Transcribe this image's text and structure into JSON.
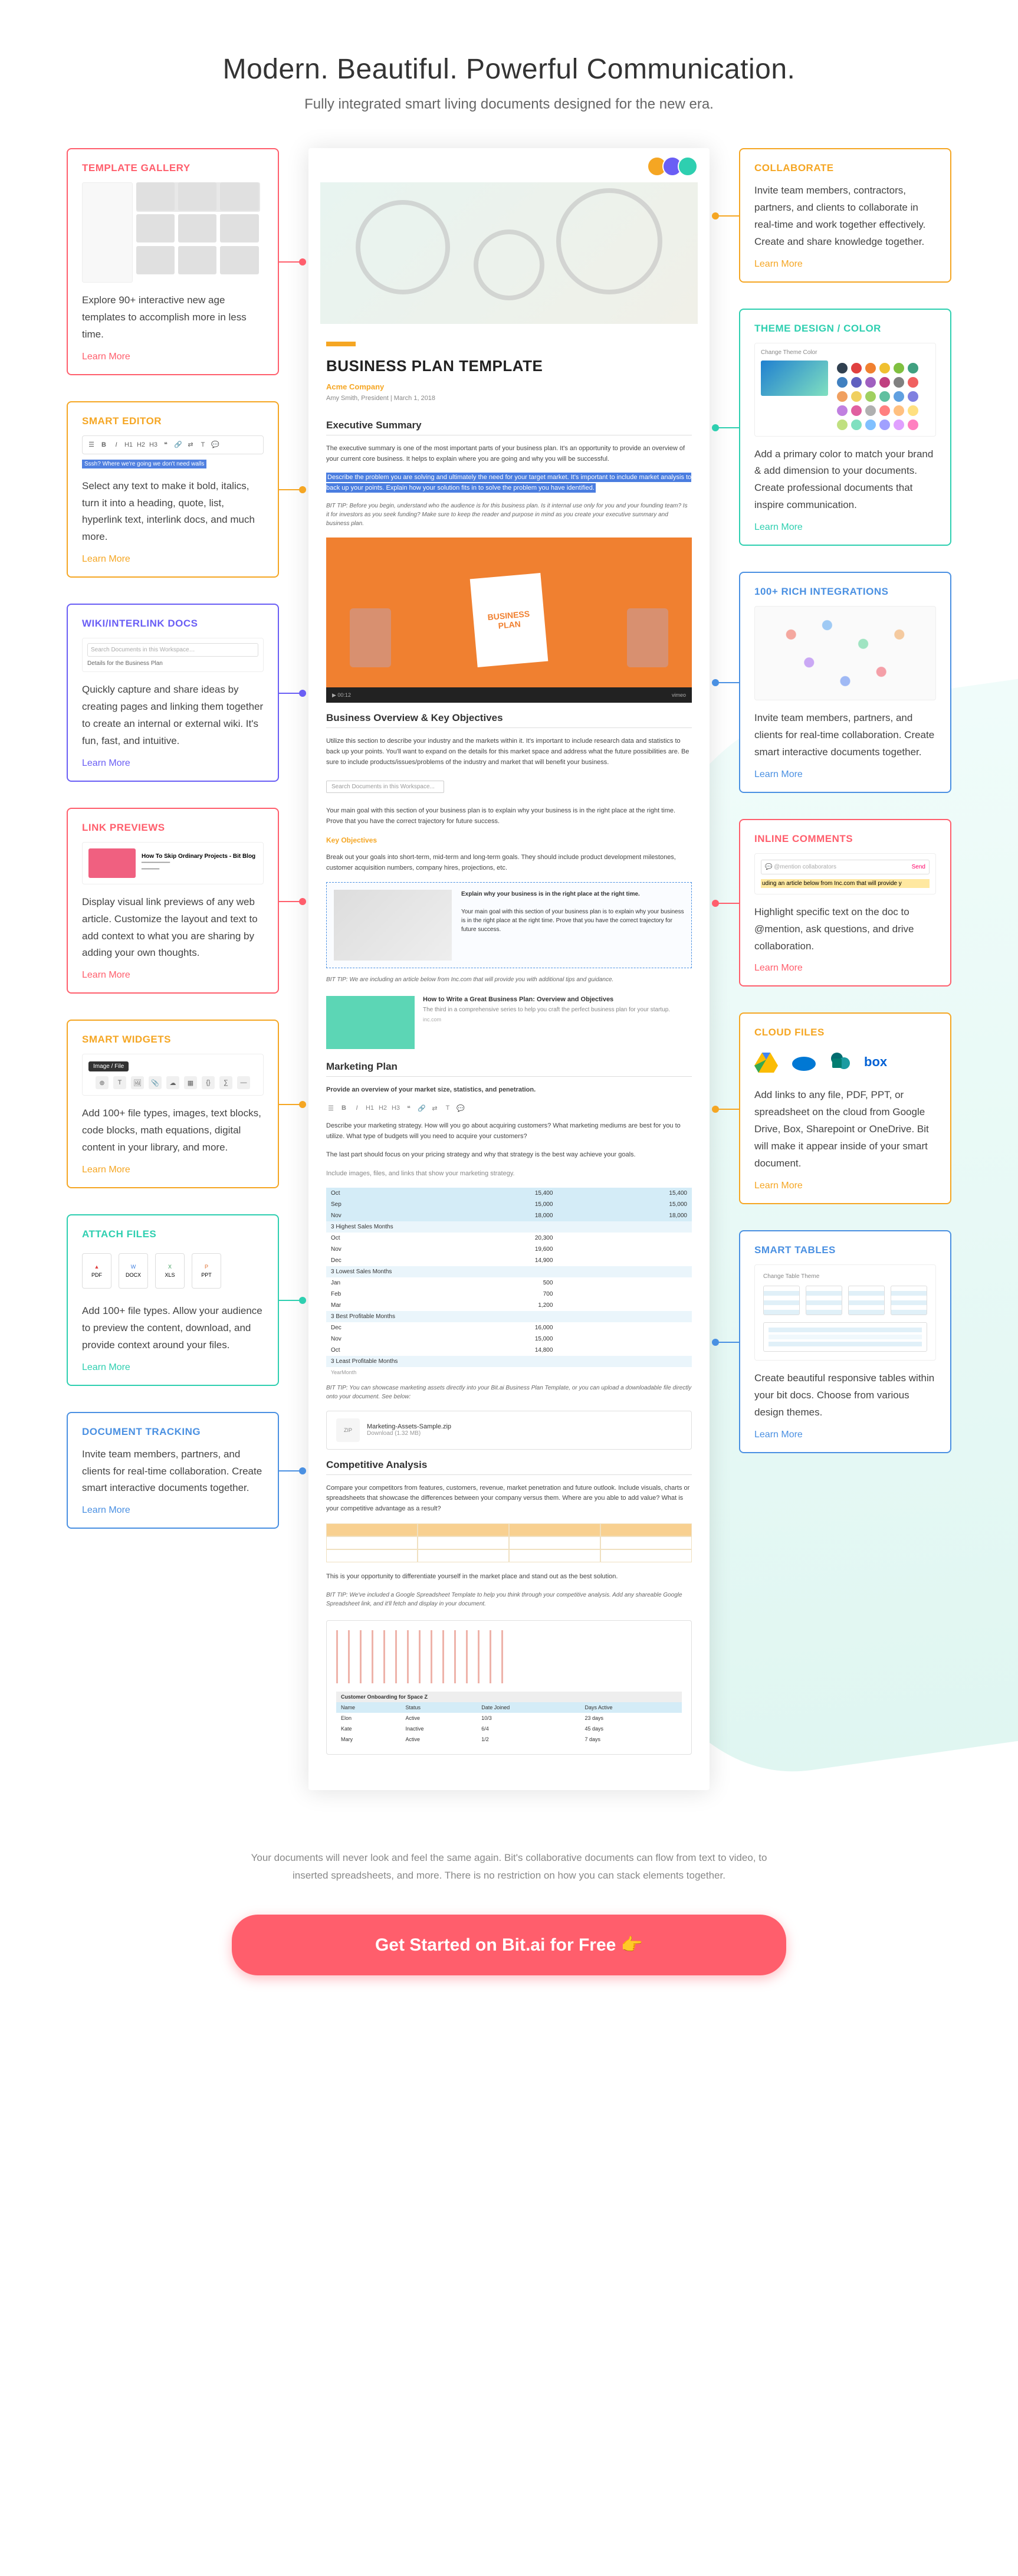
{
  "hero": {
    "title": "Modern. Beautiful. Powerful Communication.",
    "subtitle": "Fully integrated smart living documents designed for the new era."
  },
  "left_cards": [
    {
      "key": "template-gallery",
      "title": "TEMPLATE GALLERY",
      "color": "#ff5e6c",
      "desc": "Explore 90+ interactive new age templates to accomplish more in less time.",
      "learn": "Learn More",
      "thumb": "gallery"
    },
    {
      "key": "smart-editor",
      "title": "SMART EDITOR",
      "color": "#f5a623",
      "desc": "Select any text to make it bold, italics, turn it into a heading, quote, list, hyperlink text, interlink docs, and much more.",
      "learn": "Learn More",
      "thumb": "editor"
    },
    {
      "key": "wiki",
      "title": "WIKI/INTERLINK DOCS",
      "color": "#6a5ef5",
      "desc": "Quickly capture and share ideas by creating pages and linking them together to create an internal or external wiki. It's fun, fast, and intuitive.",
      "learn": "Learn More",
      "thumb": "wiki"
    },
    {
      "key": "link-previews",
      "title": "LINK PREVIEWS",
      "color": "#ff5e6c",
      "desc": "Display visual link previews of any web article. Customize the layout and text to add context to what you are sharing by adding your own thoughts.",
      "learn": "Learn More",
      "thumb": "link"
    },
    {
      "key": "smart-widgets",
      "title": "SMART WIDGETS",
      "color": "#f5a623",
      "desc": "Add 100+ file types, images, text blocks, code blocks, math equations, digital content in your library, and more.",
      "learn": "Learn More",
      "thumb": "widget"
    },
    {
      "key": "attach-files",
      "title": "ATTACH FILES",
      "color": "#2ecfb0",
      "desc": "Add 100+ file types. Allow your audience to preview the content, download, and provide context around your files.",
      "learn": "Learn More",
      "thumb": "files"
    },
    {
      "key": "document-tracking",
      "title": "DOCUMENT TRACKING",
      "color": "#4a90e2",
      "desc": "Invite team members, partners, and clients for real-time collaboration. Create smart interactive documents together.",
      "learn": "Learn More",
      "thumb": "none"
    }
  ],
  "right_cards": [
    {
      "key": "collaborate",
      "title": "COLLABORATE",
      "color": "#f5a623",
      "desc": "Invite team members, contractors, partners, and clients to collaborate in real-time and work together effectively. Create and share knowledge together.",
      "learn": "Learn More",
      "thumb": "none"
    },
    {
      "key": "theme-design",
      "title": "THEME DESIGN / COLOR",
      "color": "#2ecfb0",
      "desc": "Add a primary color to match your brand & add dimension to your documents. Create professional documents that inspire communication.",
      "learn": "Learn More",
      "thumb": "theme"
    },
    {
      "key": "integrations",
      "title": "100+ RICH Integrations",
      "color": "#4a90e2",
      "desc": "Invite team members, partners, and clients for real-time collaboration. Create smart interactive documents together.",
      "learn": "Learn More",
      "thumb": "integ"
    },
    {
      "key": "inline-comments",
      "title": "INLINE COMMENTS",
      "color": "#ff5e6c",
      "desc": "Highlight specific text on the doc to @mention, ask questions, and drive collaboration.",
      "learn": "Learn More",
      "thumb": "comment"
    },
    {
      "key": "cloud-files",
      "title": "CLOUD FILES",
      "color": "#f5a623",
      "desc": "Add links to any file, PDF, PPT, or spreadsheet on the cloud from Google Drive, Box, Sharepoint or OneDrive. Bit will make it appear inside of your smart document.",
      "learn": "Learn More",
      "thumb": "cloud"
    },
    {
      "key": "smart-tables",
      "title": "SMART TABLES",
      "color": "#4a90e2",
      "desc": "Create beautiful responsive tables within your bit docs. Choose from various design themes.",
      "learn": "Learn More",
      "thumb": "table"
    }
  ],
  "doc": {
    "title": "BUSINESS PLAN TEMPLATE",
    "company": "Acme Company",
    "meta": "Amy Smith, President | March 1, 2018",
    "h_exec": "Executive Summary",
    "exec1": "The executive summary is one of the most important parts of your business plan. It's an opportunity to provide an overview of your current core business. It helps to explain where you are going and why you will be successful.",
    "exec_hl": "Describe the problem you are solving and ultimately the need for your target market. It's important to include market analysis to back up your points. Explain how your solution fits in to solve the problem you have identified.",
    "tip1": "BIT TIP: Before you begin, understand who the audience is for this business plan. Is it internal use only for you and your founding team? Is it for investors as you seek funding? Make sure to keep the reader and purpose in mind as you create your executive summary and business plan.",
    "video_label1": "BUSINESS",
    "video_label2": "PLAN",
    "video_play": "▶ 00:12",
    "video_vimeo": "vimeo",
    "h_overview": "Business Overview & Key Objectives",
    "ov1": "Utilize this section to describe your industry and the markets within it. It's important to include research data and statistics to back up your points. You'll want to expand on the details for this market space and address what the future possibilities are. Be sure to include products/issues/problems of the industry and market that will benefit your business.",
    "search_placeholder": "Search Documents in this Workspace...",
    "ov2": "Your main goal with this section of your business plan is to explain why your business is in the right place at the right time. Prove that you have the correct trajectory for future success.",
    "sub_key": "Key Objectives",
    "key_desc": "Break out your goals into short-term, mid-term and long-term goals. They should include product development milestones, customer acquisition numbers, company hires, projections, etc.",
    "embed_title": "Explain why your business is in the right place at the right time.",
    "embed_body": "Your main goal with this section of your business plan is to explain why your business is in the right place at the right time. Prove that you have the correct trajectory for future success.",
    "tip2": "BIT TIP: We are including an article below from Inc.com that will provide you with additional tips and guidance.",
    "card_title": "How to Write a Great Business Plan: Overview and Objectives",
    "card_body": "The third in a comprehensive series to help you craft the perfect business plan for your startup.",
    "card_src": "inc.com",
    "h_marketing": "Marketing Plan",
    "mk1": "Provide an overview of your market size, statistics, and penetration.",
    "mk2": "Describe your marketing strategy. How will you go about acquiring customers? What marketing mediums are best for you to utilize. What type of budgets will you need to acquire your customers?",
    "mk3": "The last part should focus on your pricing strategy and why that strategy is the best way achieve your goals.",
    "mk4": "Include images, files, and links that show your marketing strategy.",
    "table": {
      "months": [
        {
          "label": "Oct",
          "v1": "15,400",
          "v2": "15,400"
        },
        {
          "label": "Sep",
          "v1": "15,000",
          "v2": "15,000"
        },
        {
          "label": "Nov",
          "v1": "18,000",
          "v2": "18,000"
        }
      ],
      "sec1": "3 Highest Sales Months",
      "high": [
        {
          "label": "Oct",
          "v1": "20,300",
          "v2": ""
        },
        {
          "label": "Nov",
          "v1": "19,600",
          "v2": ""
        },
        {
          "label": "Dec",
          "v1": "14,900",
          "v2": ""
        }
      ],
      "sec2": "3 Lowest Sales Months",
      "low": [
        {
          "label": "Jan",
          "v1": "500",
          "v2": ""
        },
        {
          "label": "Feb",
          "v1": "700",
          "v2": ""
        },
        {
          "label": "Mar",
          "v1": "1,200",
          "v2": ""
        }
      ],
      "sec3": "3 Best Profitable Months",
      "best": [
        {
          "label": "Dec",
          "v1": "16,000",
          "v2": ""
        },
        {
          "label": "Nov",
          "v1": "15,000",
          "v2": ""
        },
        {
          "label": "Oct",
          "v1": "14,800",
          "v2": ""
        }
      ],
      "sec4": "3 Least Profitable Months",
      "least_note": "YearMonth"
    },
    "tip3": "BIT TIP: You can showcase marketing assets directly into your Bit.ai Business Plan Template, or you can upload a downloadable file directly onto your document. See below:",
    "file_name": "Marketing-Assets-Sample.zip",
    "file_meta": "Download (1.32 MB)",
    "h_comp": "Competitive Analysis",
    "comp1": "Compare your competitors from features, customers, revenue, market penetration and future outlook. Include visuals, charts or spreadsheets that showcase the differences between your company versus them. Where are you able to add value? What is your competitive advantage as a result?",
    "comp2": "This is your opportunity to differentiate yourself in the market place and stand out as the best solution.",
    "tip4": "BIT TIP: We've included a Google Spreadsheet Template to help you think through your competitive analysis. Add any shareable Google Spreadsheet link, and it'll fetch and display in your document.",
    "sheet_title": "Customer Onboarding for Space Z",
    "sheet_cols": [
      "Name",
      "Status",
      "Date Joined",
      "Days Active"
    ],
    "sheet_rows": [
      [
        "Elon",
        "Active",
        "10/3",
        "23 days"
      ],
      [
        "Kate",
        "Inactive",
        "6/4",
        "45 days"
      ],
      [
        "Mary",
        "Active",
        "1/2",
        "7 days"
      ]
    ]
  },
  "wiki_search": "Search Documents in this Workspace…",
  "wiki_detail": "Details for the Business Plan",
  "editor_hint": "Sssh? Where we're going we don't need walls",
  "link_title": "How To Skip Ordinary Projects - Bit Blog",
  "comment_placeholder": "@mention collaborators",
  "comment_send": "Send",
  "comment_line": "uding an article below from Inc.com that will provide y",
  "theme_label": "Change Theme Color",
  "table_label": "Change Table Theme",
  "footer": "Your documents will never look and feel the same again. Bit's collaborative documents can flow from text to video, to inserted spreadsheets, and more. There is no restriction on how you can stack elements together.",
  "cta": "Get Started on Bit.ai for Free 👉"
}
